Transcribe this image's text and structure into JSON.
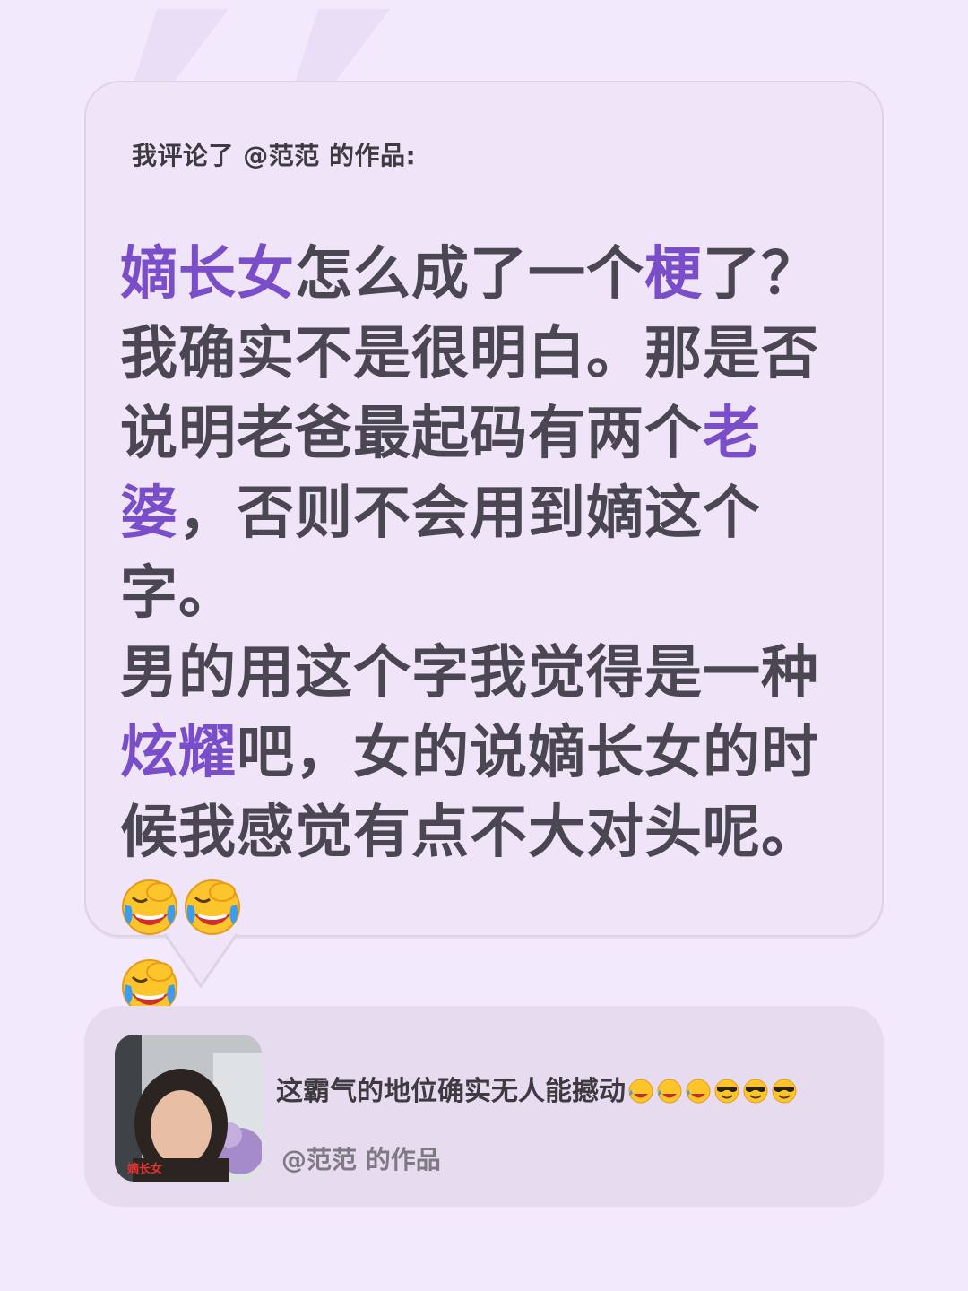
{
  "header": "我评论了 @范范 的作品:",
  "comment": {
    "runs": [
      {
        "text": "嫡长女",
        "hl": true
      },
      {
        "text": "怎么成了一个",
        "hl": false
      },
      {
        "text": "梗",
        "hl": true
      },
      {
        "text": "了？我确实不是很明白。那是否说明老爸最起码有两个",
        "hl": false
      },
      {
        "text": "老婆",
        "hl": true
      },
      {
        "text": "，否则不会用到嫡这个字。",
        "hl": false
      },
      {
        "text": "男的用这个字我觉得是一种",
        "hl": false
      },
      {
        "text": "炫耀",
        "hl": true
      },
      {
        "text": "吧，女的说嫡长女的时候我感觉有点不大对头呢。",
        "hl": false
      }
    ],
    "line_break_after_run": 5,
    "trailing_emojis": [
      "loudly-crying-laughing-emoji",
      "loudly-crying-laughing-emoji",
      "loudly-crying-laughing-emoji"
    ]
  },
  "reply": {
    "text": "这霸气的地位确实无人能撼动",
    "emojis": [
      "rofl-emoji",
      "rofl-emoji",
      "rofl-emoji",
      "sunglasses-emoji",
      "sunglasses-emoji",
      "sunglasses-emoji"
    ],
    "source": "@范范 的作品",
    "thumbnail_caption": "嫡长女"
  },
  "colors": {
    "background": "#f3e9fd",
    "card": "#efe4f8",
    "highlight": "#7a4ec9",
    "text": "#4a4652"
  }
}
